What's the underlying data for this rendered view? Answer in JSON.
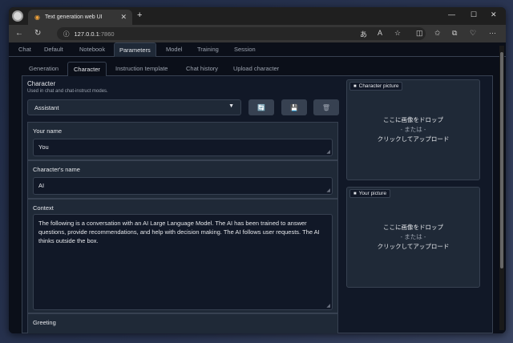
{
  "browser": {
    "tab_title": "Text generation web UI",
    "address_host": "127.0.0.1",
    "address_port": ":7860"
  },
  "main_tabs": [
    "Chat",
    "Default",
    "Notebook",
    "Parameters",
    "Model",
    "Training",
    "Session"
  ],
  "sub_tabs": [
    "Generation",
    "Character",
    "Instruction template",
    "Chat history",
    "Upload character"
  ],
  "character": {
    "label": "Character",
    "info": "Used in chat and chat-instruct modes.",
    "selected": "Assistant"
  },
  "fields": {
    "your_name_label": "Your name",
    "your_name_value": "You",
    "char_name_label": "Character's name",
    "char_name_value": "AI",
    "context_label": "Context",
    "context_value": "The following is a conversation with an AI Large Language Model. The AI has been trained to answer questions, provide recommendations, and help with decision making. The AI follows user requests. The AI thinks outside the box.",
    "greeting_label": "Greeting"
  },
  "pictures": {
    "character_label": "Character picture",
    "your_label": "Your picture",
    "drop_line1": "ここに画像をドロップ",
    "drop_line2": "- または -",
    "drop_line3": "クリックしてアップロード"
  },
  "colors": {
    "background": "#0b0f19",
    "panel": "#1f2937",
    "border": "#374151",
    "text": "#e5e7eb",
    "refresh_icon": "#3b82f6",
    "save_icon": "#e11d48"
  },
  "icons": [
    "refresh-icon",
    "save-icon",
    "trash-icon",
    "image-icon"
  ]
}
